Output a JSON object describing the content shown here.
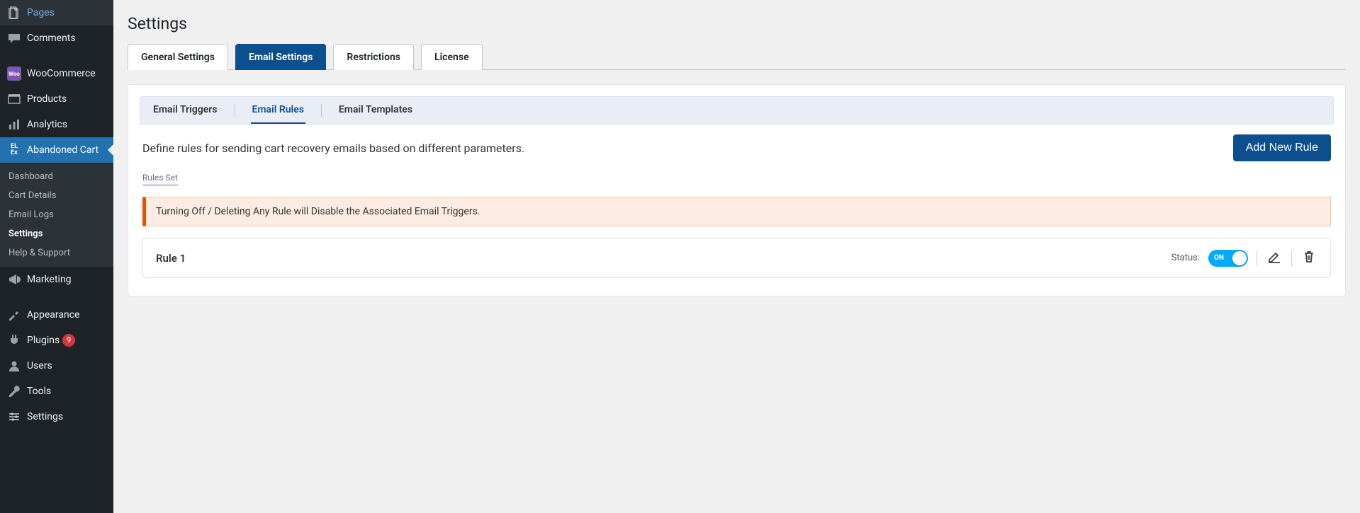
{
  "sidebar": {
    "items": [
      {
        "label": "Pages",
        "icon": "pages-icon"
      },
      {
        "label": "Comments",
        "icon": "comments-icon"
      },
      {
        "label": "WooCommerce",
        "icon": "woo-icon"
      },
      {
        "label": "Products",
        "icon": "products-icon"
      },
      {
        "label": "Analytics",
        "icon": "analytics-icon"
      },
      {
        "label": "Abandoned Cart",
        "icon": "elex-icon",
        "active": true
      },
      {
        "label": "Marketing",
        "icon": "marketing-icon"
      },
      {
        "label": "Appearance",
        "icon": "appearance-icon"
      },
      {
        "label": "Plugins",
        "icon": "plugins-icon",
        "badge": "9"
      },
      {
        "label": "Users",
        "icon": "users-icon"
      },
      {
        "label": "Tools",
        "icon": "tools-icon"
      },
      {
        "label": "Settings",
        "icon": "settings-icon"
      }
    ],
    "submenu": [
      {
        "label": "Dashboard"
      },
      {
        "label": "Cart Details"
      },
      {
        "label": "Email Logs"
      },
      {
        "label": "Settings",
        "current": true
      },
      {
        "label": "Help & Support"
      }
    ]
  },
  "page": {
    "title": "Settings",
    "tabs": [
      {
        "label": "General Settings"
      },
      {
        "label": "Email Settings",
        "active": true
      },
      {
        "label": "Restrictions"
      },
      {
        "label": "License"
      }
    ],
    "subtabs": [
      {
        "label": "Email Triggers"
      },
      {
        "label": "Email Rules",
        "active": true
      },
      {
        "label": "Email Templates"
      }
    ],
    "description": "Define rules for sending cart recovery emails based on different parameters.",
    "add_button": "Add New Rule",
    "section_label": "Rules Set",
    "warning": "Turning Off / Deleting Any Rule will Disable the Associated Email Triggers.",
    "rule": {
      "name": "Rule 1",
      "status_label": "Status:",
      "toggle_text": "ON"
    }
  }
}
